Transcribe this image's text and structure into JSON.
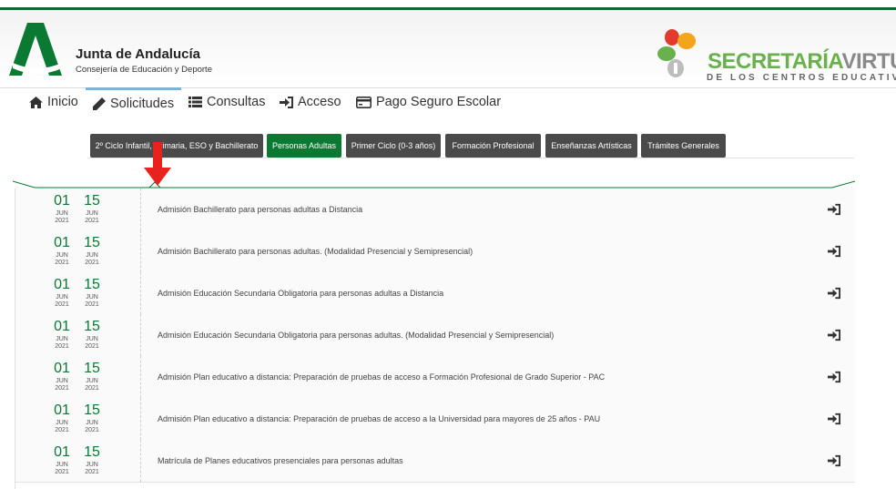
{
  "header": {
    "org_name": "Junta de Andalucía",
    "org_sub": "Consejería de Educación y Deporte",
    "sv_title_a": "SECRETARÍA",
    "sv_title_b": "VIRTUAL",
    "sv_sub": "DE LOS CENTROS EDUCATIVOS"
  },
  "nav": {
    "items": [
      {
        "label": "Inicio",
        "icon": "home-icon"
      },
      {
        "label": "Solicitudes",
        "icon": "pencil-icon"
      },
      {
        "label": "Consultas",
        "icon": "list-icon"
      },
      {
        "label": "Acceso",
        "icon": "sign-in-icon"
      },
      {
        "label": "Pago Seguro Escolar",
        "icon": "credit-card-icon"
      }
    ],
    "active": "Solicitudes"
  },
  "tabs": [
    {
      "label": "2º Ciclo Infantil, Primaria, ESO y Bachillerato",
      "active": false
    },
    {
      "label": "Personas Adultas",
      "active": true
    },
    {
      "label": "Primer Ciclo (0-3 años)",
      "active": false
    },
    {
      "label": "Formación Profesional",
      "active": false
    },
    {
      "label": "Enseñanzas Artísticas",
      "active": false
    },
    {
      "label": "Trámites Generales",
      "active": false
    }
  ],
  "colors": {
    "brand_green": "#0a7a33",
    "tab_dark": "#4a4a4a",
    "annotation_arrow": "#e8231d"
  },
  "rows": [
    {
      "start_day": "01",
      "start_month": "JUN",
      "start_year": "2021",
      "end_day": "15",
      "end_month": "JUN",
      "end_year": "2021",
      "title": "Admisión Bachillerato para personas adultas a Distancia"
    },
    {
      "start_day": "01",
      "start_month": "JUN",
      "start_year": "2021",
      "end_day": "15",
      "end_month": "JUN",
      "end_year": "2021",
      "title": "Admisión Bachillerato para personas adultas. (Modalidad Presencial y Semipresencial)"
    },
    {
      "start_day": "01",
      "start_month": "JUN",
      "start_year": "2021",
      "end_day": "15",
      "end_month": "JUN",
      "end_year": "2021",
      "title": "Admisión Educación Secundaria Obligatoria para personas adultas a Distancia"
    },
    {
      "start_day": "01",
      "start_month": "JUN",
      "start_year": "2021",
      "end_day": "15",
      "end_month": "JUN",
      "end_year": "2021",
      "title": "Admisión Educación Secundaria Obligatoria para personas adultas. (Modalidad Presencial y Semipresencial)"
    },
    {
      "start_day": "01",
      "start_month": "JUN",
      "start_year": "2021",
      "end_day": "15",
      "end_month": "JUN",
      "end_year": "2021",
      "title": "Admisión Plan educativo a distancia: Preparación de pruebas de acceso a Formación Profesional de Grado Superior - PAC"
    },
    {
      "start_day": "01",
      "start_month": "JUN",
      "start_year": "2021",
      "end_day": "15",
      "end_month": "JUN",
      "end_year": "2021",
      "title": "Admisión Plan educativo a distancia: Preparación de pruebas de acceso a la Universidad para mayores de 25 años - PAU"
    },
    {
      "start_day": "01",
      "start_month": "JUN",
      "start_year": "2021",
      "end_day": "15",
      "end_month": "JUN",
      "end_year": "2021",
      "title": "Matrícula de Planes educativos presenciales para personas adultas"
    }
  ]
}
